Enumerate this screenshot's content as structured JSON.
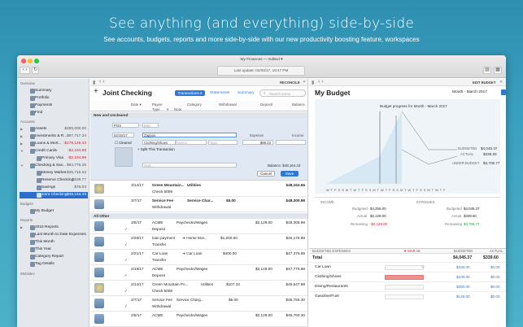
{
  "hero": {
    "title": "See anything (and everything) side-by-side",
    "subtitle": "See accounts, budgets, reports and more side-by-side with our new productivity boosting feature, workspaces"
  },
  "window": {
    "title": "My Finances — Edited ▾",
    "last_update": "Last update: 02/03/17, 10:47 PM"
  },
  "sidebar": {
    "sections": {
      "overview": "Overview",
      "accounts": "Accounts",
      "budgets": "Budgets",
      "reports": "Reports",
      "websites": "Websites"
    },
    "overview": [
      {
        "label": "Summary"
      },
      {
        "label": "Portfolio"
      },
      {
        "label": "Payments"
      },
      {
        "label": "Find"
      }
    ],
    "accounts": [
      {
        "label": "Assets",
        "amount": "$285,000.00"
      },
      {
        "label": "Investments & R...",
        "amount": "$87,717.34"
      },
      {
        "label": "Loans & Mort...",
        "amount": "-$179,146.43"
      },
      {
        "label": "Credit Cards",
        "amount": "-$2,194.99"
      },
      {
        "label": "Primary Visa",
        "amount": "-$2,194.99"
      },
      {
        "label": "Checking & Sav...",
        "amount": "$84,776.26"
      },
      {
        "label": "Money Market",
        "amount": "$35,715.03"
      },
      {
        "label": "Reserve Checking",
        "amount": "$839.77"
      },
      {
        "label": "Savings",
        "amount": "$76.03"
      },
      {
        "label": "Joint Checking",
        "amount": "$48,164.43"
      }
    ],
    "budgets": [
      {
        "label": "My Budget"
      }
    ],
    "reports": [
      {
        "label": "2016 Reports"
      },
      {
        "label": "Last Month to Date Expenses"
      },
      {
        "label": "This Month"
      },
      {
        "label": "This Year"
      },
      {
        "label": "Category Report"
      },
      {
        "label": "Tag Details"
      }
    ]
  },
  "register": {
    "nav_label": "RECONCILE",
    "title": "Joint Checking",
    "transactions_btn": "Transactions ▾",
    "tab_statements": "Statements",
    "tab_summary": "Summary",
    "search_placeholder": "Search terms",
    "columns": {
      "date": "Date ▾",
      "payee": "Payee",
      "type": "Type",
      "hash": "#",
      "note": "Note",
      "category": "Category",
      "withdrawal": "Withdrawal",
      "deposit": "Deposit",
      "balance": "Balance"
    },
    "new_section": "New and Uncleared",
    "editor": {
      "type": "POS",
      "type2": "(no)",
      "date": "02/15/17",
      "payee": "Zappos",
      "category": "Clothing/Shoes",
      "memo_placeholder": "Memo",
      "tags_placeholder": "Tags",
      "cleared": "Cleared",
      "expense_label": "Expense",
      "income_label": "Income",
      "expense": "$89.23",
      "split": "Split This Transaction",
      "note_placeholder": "Note",
      "balance": "Balance: $48,164.43",
      "cancel": "Cancel",
      "save": "Save"
    },
    "new_rows": [
      {
        "date": "3/14/17",
        "payee": "Green Mountain...",
        "category": "Utilities",
        "type": "Check 5009",
        "withdrawal": "",
        "deposit": "",
        "balance": "$48,163.66"
      },
      {
        "date": "3/7/17",
        "payee": "Service Fee",
        "category": "Service Char...",
        "type": "Withdrawal",
        "withdrawal": "$5.00",
        "deposit": "",
        "balance": "$48,300.98"
      }
    ],
    "other_section": "All Other",
    "rows": [
      {
        "date": "3/5/17",
        "payee": "ACME",
        "category": "Paychecks/Wages",
        "type": "Deposit",
        "withdrawal": "",
        "deposit": "$2,129.00",
        "balance": "$48,305.98"
      },
      {
        "date": "2/28/17",
        "payee": "loan payment",
        "category": "➜ Home Mor...",
        "type": "Transfer",
        "withdrawal": "$1,200.00",
        "deposit": "",
        "balance": "$46,176.98"
      },
      {
        "date": "2/21/17",
        "payee": "Car Loan",
        "category": "➜ Car Loan",
        "type": "Transfer",
        "withdrawal": "$400.00",
        "deposit": "",
        "balance": "$47,376.98"
      },
      {
        "date": "2/19/17",
        "payee": "ACME",
        "category": "Paychecks/Wages",
        "type": "Deposit",
        "withdrawal": "",
        "deposit": "$2,129.00",
        "balance": "$47,776.98"
      },
      {
        "date": "2/14/17",
        "payee": "Green Mountain Po...",
        "category": "Utilities",
        "type": "Check 5008",
        "withdrawal": "$107.32",
        "deposit": "",
        "balance": "$45,647.98"
      },
      {
        "date": "2/7/17",
        "payee": "Service Fee",
        "category": "Service Charg...",
        "type": "Withdrawal",
        "withdrawal": "$5.00",
        "deposit": "",
        "balance": "$45,755.30"
      },
      {
        "date": "2/5/17",
        "payee": "ACME",
        "category": "Paychecks/Wages",
        "type": "",
        "withdrawal": "",
        "deposit": "$2,129.00",
        "balance": "$45,760.30"
      }
    ]
  },
  "budget": {
    "nav_label": "EDIT BUDGET",
    "title": "My Budget",
    "period": "Month - March 2017",
    "chart_title": "Budget progress for Month - March 2017",
    "legend": {
      "budgeted": "BUDGETED",
      "budgeted_val": "$4,045.37",
      "actual": "ACTUAL",
      "actual_val": "$339.60",
      "under": "UNDER BUDGET",
      "under_val": "$3,705.77"
    },
    "days": "W T F S S M T W T F S S M T W T F S S M T W T F S S M T W T F",
    "income": {
      "label": "INCOME",
      "budgeted_lbl": "Budgeted",
      "budgeted": "$4,258.00",
      "actual_lbl": "Actual",
      "actual": "$2,129.00",
      "remaining_lbl": "Remaining",
      "remaining": "-$2,129.00"
    },
    "expenses": {
      "label": "EXPENSES",
      "budgeted_lbl": "Budgeted",
      "budgeted": "$4,045.37",
      "actual_lbl": "Actual",
      "actual": "$339.60",
      "remaining_lbl": "Remaining",
      "remaining": "$3,705.77"
    },
    "table": {
      "h_name": "BUDGETED EXPENSES",
      "h_marker": "▼ MAR 15",
      "h_budgeted": "BUDGETED",
      "h_actual": "ACTUAL",
      "total": {
        "name": "Total",
        "budgeted": "$4,045.37",
        "actual": "$339.60"
      },
      "rows": [
        {
          "name": "Car Loan",
          "budgeted": "$430.00",
          "actual": "$0.00",
          "fill": 0
        },
        {
          "name": "Clothing/Shoes",
          "budgeted": "$100.00",
          "actual": "$0.00",
          "fill": 1
        },
        {
          "name": "Dining/Restaurants",
          "budgeted": "$350.00",
          "actual": "$0.00",
          "fill": 0
        },
        {
          "name": "Gasoline/Fuel",
          "budgeted": "$125.00",
          "actual": "$0.00",
          "fill": 0
        }
      ]
    }
  }
}
